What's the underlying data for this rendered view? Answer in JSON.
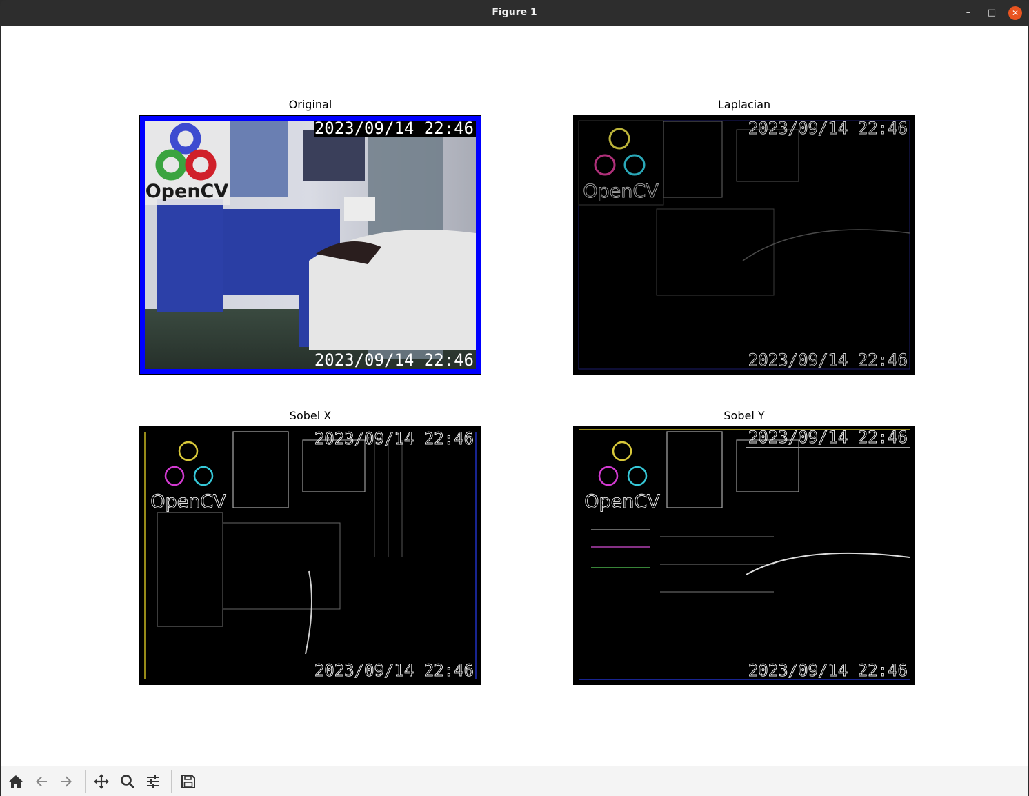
{
  "window": {
    "title": "Figure 1"
  },
  "window_controls": {
    "minimize": "–",
    "maximize": "□",
    "close": "✕"
  },
  "figure": {
    "subplots": [
      {
        "title": "Original",
        "timestamp_top": "2023/09/14 22:46",
        "timestamp_bottom": "2023/09/14 22:46",
        "logo_text": "OpenCV"
      },
      {
        "title": "Laplacian",
        "timestamp_top": "2023/09/14 22:46",
        "timestamp_bottom": "2023/09/14 22:46",
        "logo_text": "OpenCV"
      },
      {
        "title": "Sobel X",
        "timestamp_top": "2023/09/14 22:46",
        "timestamp_bottom": "2023/09/14 22:46",
        "logo_text": "OpenCV"
      },
      {
        "title": "Sobel Y",
        "timestamp_top": "2023/09/14 22:46",
        "timestamp_bottom": "2023/09/14 22:46",
        "logo_text": "OpenCV"
      }
    ]
  },
  "toolbar": {
    "buttons": [
      {
        "icon": "home-icon"
      },
      {
        "icon": "back-arrow-icon"
      },
      {
        "icon": "forward-arrow-icon"
      },
      {
        "icon": "pan-icon"
      },
      {
        "icon": "zoom-icon"
      },
      {
        "icon": "configure-subplots-icon"
      },
      {
        "icon": "save-icon"
      }
    ]
  },
  "colors": {
    "titlebar": "#2d2d2d",
    "close_button": "#e95420",
    "original_border": "#0000ff",
    "edge_background": "#000000"
  }
}
